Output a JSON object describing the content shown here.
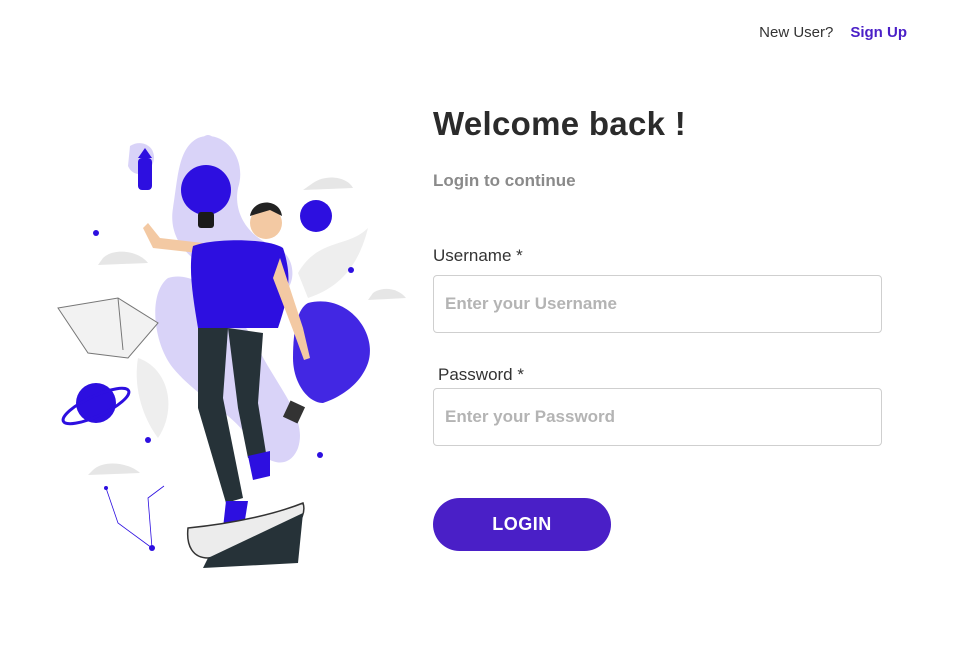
{
  "header": {
    "question": "New User?",
    "signup_label": "Sign Up"
  },
  "form": {
    "title": "Welcome back !",
    "subtitle": "Login to continue",
    "username_label": "Username",
    "username_placeholder": "Enter your Username",
    "password_label": "Password",
    "password_placeholder": "Enter your Password",
    "required_marker": "*",
    "login_label": "LOGIN"
  },
  "colors": {
    "accent": "#4a1fc7",
    "illustration_blue": "#2d0fe0",
    "illustration_lavender": "#cfc8f5"
  },
  "illustration": {
    "name": "man-juggling-ideas-illustration"
  }
}
